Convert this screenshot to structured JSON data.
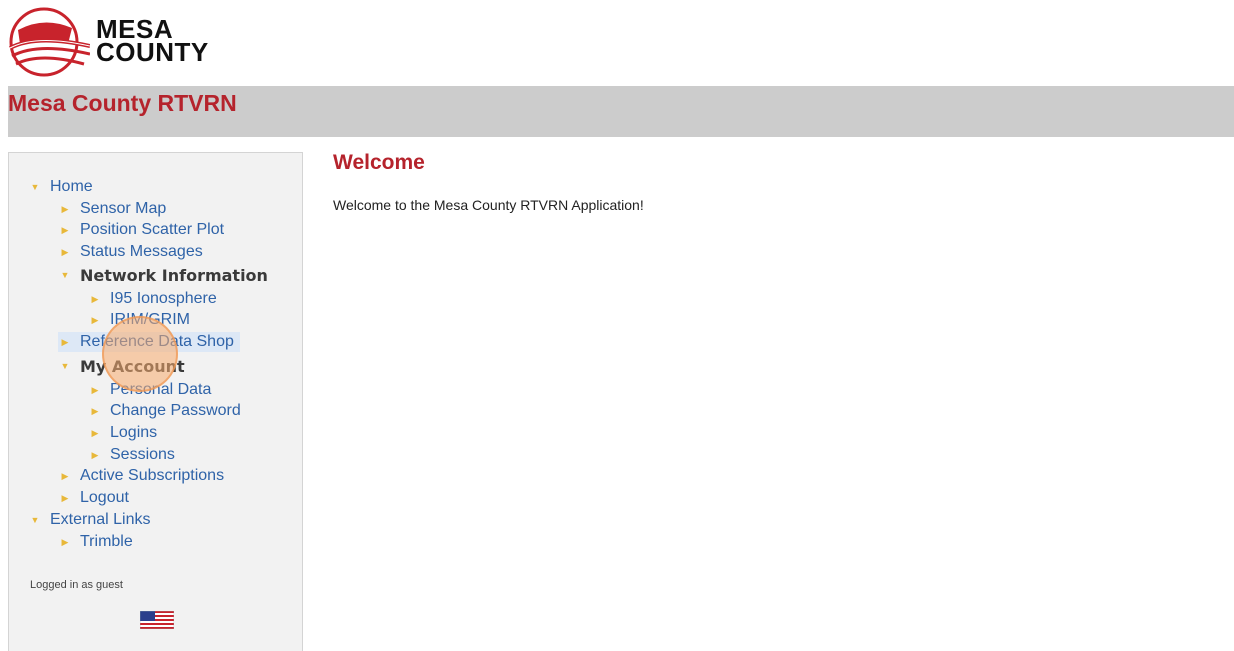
{
  "logo": {
    "line1": "MESA",
    "line2": "COUNTY",
    "icon": "mesa-county-seal-logo"
  },
  "header": {
    "title": "Mesa County RTVRN"
  },
  "sidebar": {
    "nav": {
      "home": "Home",
      "sensor_map": "Sensor Map",
      "position_scatter_plot": "Position Scatter Plot",
      "status_messages": "Status Messages",
      "network_information": "Network Information",
      "i95_ionosphere": "I95 Ionosphere",
      "irim_grim": "IRIM/GRIM",
      "reference_data_shop": "Reference Data Shop",
      "my_account": "My Account",
      "personal_data": "Personal Data",
      "change_password": "Change Password",
      "logins": "Logins",
      "sessions": "Sessions",
      "active_subscriptions": "Active Subscriptions",
      "logout": "Logout",
      "external_links": "External Links",
      "trimble": "Trimble"
    },
    "status": "Logged in as guest",
    "language_icon": "us-flag-icon"
  },
  "main": {
    "heading": "Welcome",
    "message": "Welcome to the Mesa County RTVRN Application!"
  },
  "colors": {
    "brand_red": "#b5232c",
    "link_blue": "#2f63a8",
    "triangle_gold": "#e8b83a",
    "header_gray": "#cccccc",
    "sidebar_bg": "#f2f2f2"
  }
}
